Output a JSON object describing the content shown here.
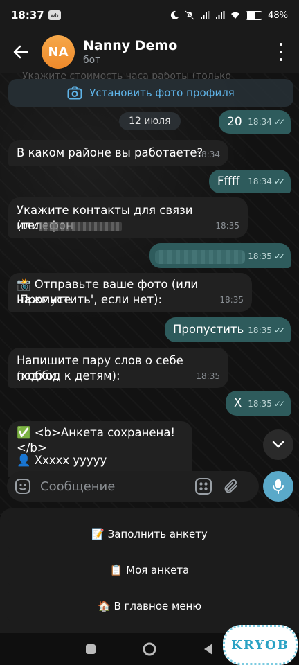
{
  "status": {
    "time": "18:37",
    "badge": "wb",
    "battery": "48%"
  },
  "chat": {
    "title": "Nanny Demo",
    "subtitle": "бот",
    "avatar_initials": "NA"
  },
  "banner": {
    "faded_text": "Укажите стоимость часа работы (только",
    "set_photo": "Установить фото профиля"
  },
  "date_label": "12 июля",
  "messages": [
    {
      "side": "out",
      "text": "20",
      "time": "18:34"
    },
    {
      "side": "in",
      "text": "В каком районе вы работаете?",
      "time": "18:34"
    },
    {
      "side": "out",
      "text": "Fffff",
      "time": "18:34"
    },
    {
      "side": "in",
      "text_1": "Укажите контакты для связи (телефон",
      "text_2": "или",
      "time": "18:35"
    },
    {
      "side": "out",
      "text": "",
      "time": "18:35"
    },
    {
      "side": "in",
      "text_1": "📸 Отправьте ваше фото (или нажмите",
      "text_2": "'Пропустить', если нет):",
      "time": "18:35"
    },
    {
      "side": "out",
      "text": "Пропустить",
      "time": "18:35"
    },
    {
      "side": "in",
      "text_1": "Напишите пару слов о себе (хобби,",
      "text_2": "подход к детям):",
      "time": "18:35"
    },
    {
      "side": "out",
      "text": "X",
      "time": "18:35"
    },
    {
      "side": "in",
      "text_1": "✅ <b>Анкета сохранена!</b>",
      "text_2": "👤 Xxxxx yyyyy",
      "time": ""
    }
  ],
  "composer": {
    "placeholder": "Сообщение"
  },
  "keyboard": {
    "buttons": [
      "📝 Заполнить анкету",
      "📋 Моя анкета",
      "🏠 В главное меню"
    ]
  },
  "watermark": "KRYOB",
  "colors": {
    "outgoing_bubble": "#2e5b5c",
    "incoming_bubble": "#212121",
    "accent": "#5fb4e8",
    "mic_button": "#5aa9c9",
    "avatar": "#ef8a2b"
  },
  "icons": {
    "back": "arrow-left-icon",
    "menu": "kebab-icon",
    "camera": "camera-icon",
    "emoji": "sticker-icon",
    "attach": "paperclip-icon",
    "bot_keyboard": "keyboard-grid-icon",
    "mic": "mic-icon",
    "scroll": "chevron-down-icon"
  }
}
